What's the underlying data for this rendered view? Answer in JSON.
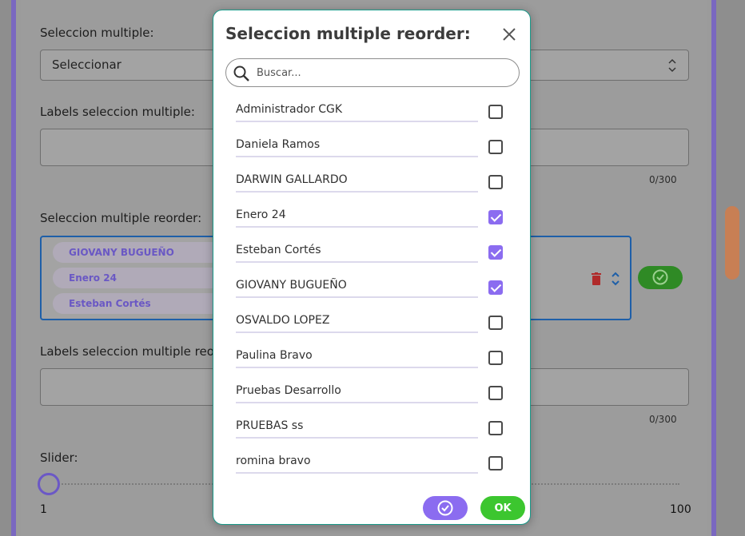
{
  "background": {
    "field1_label": "Seleccion multiple:",
    "field1_value": "Seleccionar",
    "field2_label": "Labels seleccion multiple:",
    "field2_counter": "0/300",
    "field3_label": "Seleccion multiple reorder:",
    "chips": [
      "GIOVANY BUGUEÑO",
      "Enero 24",
      "Esteban Cortés"
    ],
    "field4_label": "Labels seleccion multiple reorder:",
    "field4_counter": "0/300",
    "slider_label": "Slider:",
    "slider_min": "1",
    "slider_max": "100",
    "slider_value": 1
  },
  "modal": {
    "title": "Seleccion multiple reorder:",
    "search_placeholder": "Buscar...",
    "options": [
      {
        "label": "Administrador CGK",
        "checked": false
      },
      {
        "label": "Daniela Ramos",
        "checked": false
      },
      {
        "label": "DARWIN GALLARDO",
        "checked": false
      },
      {
        "label": "Enero 24",
        "checked": true
      },
      {
        "label": "Esteban Cortés",
        "checked": true
      },
      {
        "label": "GIOVANY BUGUEÑO",
        "checked": true
      },
      {
        "label": "OSVALDO LOPEZ",
        "checked": false
      },
      {
        "label": "Paulina Bravo",
        "checked": false
      },
      {
        "label": "Pruebas Desarrollo",
        "checked": false
      },
      {
        "label": "PRUEBAS ss",
        "checked": false
      },
      {
        "label": "romina bravo",
        "checked": false
      }
    ],
    "ok_label": "OK"
  },
  "colors": {
    "accent_purple": "#8b6cf0",
    "ok_green": "#3cc62f",
    "modal_border": "#1a9a8a"
  }
}
